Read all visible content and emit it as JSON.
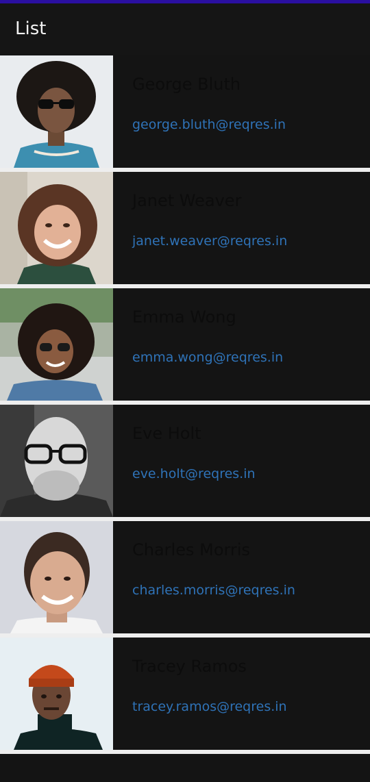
{
  "app_bar": {
    "title": "List"
  },
  "users": [
    {
      "name": "George Bluth",
      "email": "george.bluth@reqres.in"
    },
    {
      "name": "Janet Weaver",
      "email": "janet.weaver@reqres.in"
    },
    {
      "name": "Emma Wong",
      "email": "emma.wong@reqres.in"
    },
    {
      "name": "Eve Holt",
      "email": "eve.holt@reqres.in"
    },
    {
      "name": "Charles Morris",
      "email": "charles.morris@reqres.in"
    },
    {
      "name": "Tracey Ramos",
      "email": "tracey.ramos@reqres.in"
    }
  ]
}
